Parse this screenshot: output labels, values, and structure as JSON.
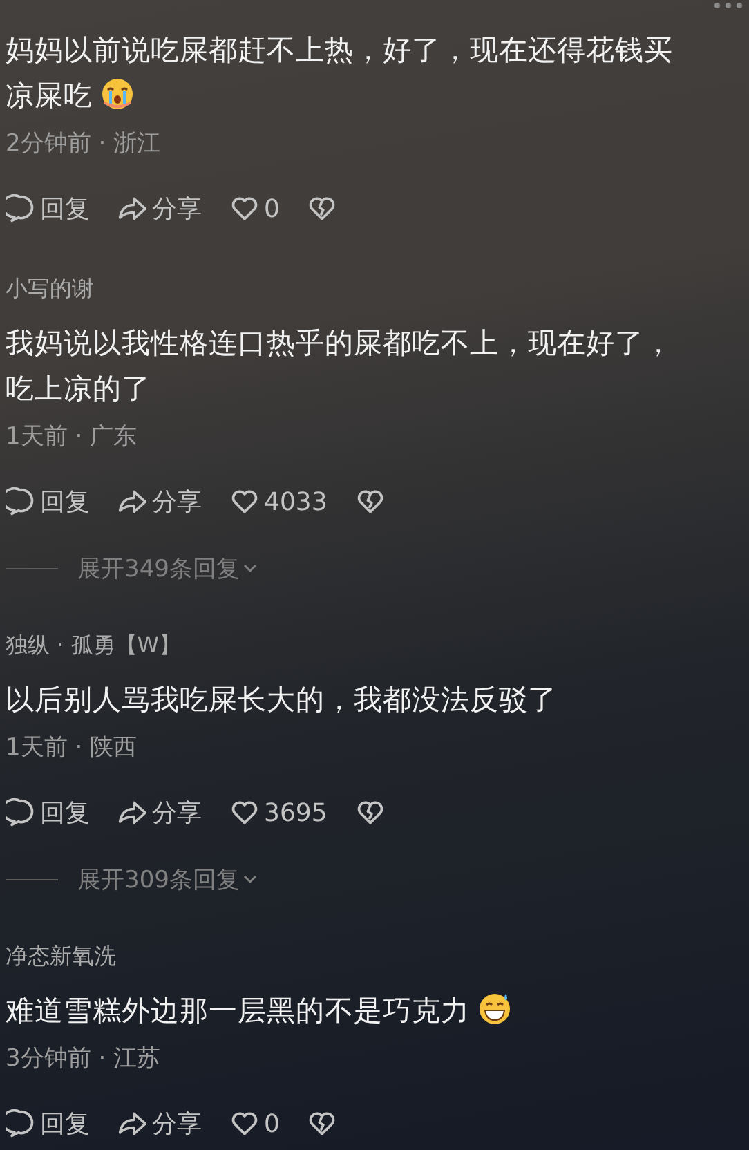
{
  "comments": [
    {
      "text": "妈妈以前说吃屎都赶不上热，好了，现在还得花钱买凉屎吃",
      "sticker": {
        "kind": "crying"
      },
      "meta": "2分钟前 · 浙江",
      "reply_label": "回复",
      "share_label": "分享",
      "likes": "0"
    },
    {
      "username": "小写的谢",
      "text": "我妈说以我性格连口热乎的屎都吃不上，现在好了，吃上凉的了",
      "meta": "1天前 · 广东",
      "reply_label": "回复",
      "share_label": "分享",
      "likes": "4033",
      "expand": "展开349条回复"
    },
    {
      "username": "独纵 · 孤勇【W】",
      "text": "以后别人骂我吃屎长大的，我都没法反驳了",
      "meta": "1天前 · 陕西",
      "reply_label": "回复",
      "share_label": "分享",
      "likes": "3695",
      "expand": "展开309条回复"
    },
    {
      "username": "净态新氧洗",
      "text": "难道雪糕外边那一层黑的不是巧克力",
      "sticker": {
        "kind": "grin-sweat"
      },
      "meta": "3分钟前 · 江苏",
      "reply_label": "回复",
      "share_label": "分享",
      "likes": "0"
    }
  ]
}
